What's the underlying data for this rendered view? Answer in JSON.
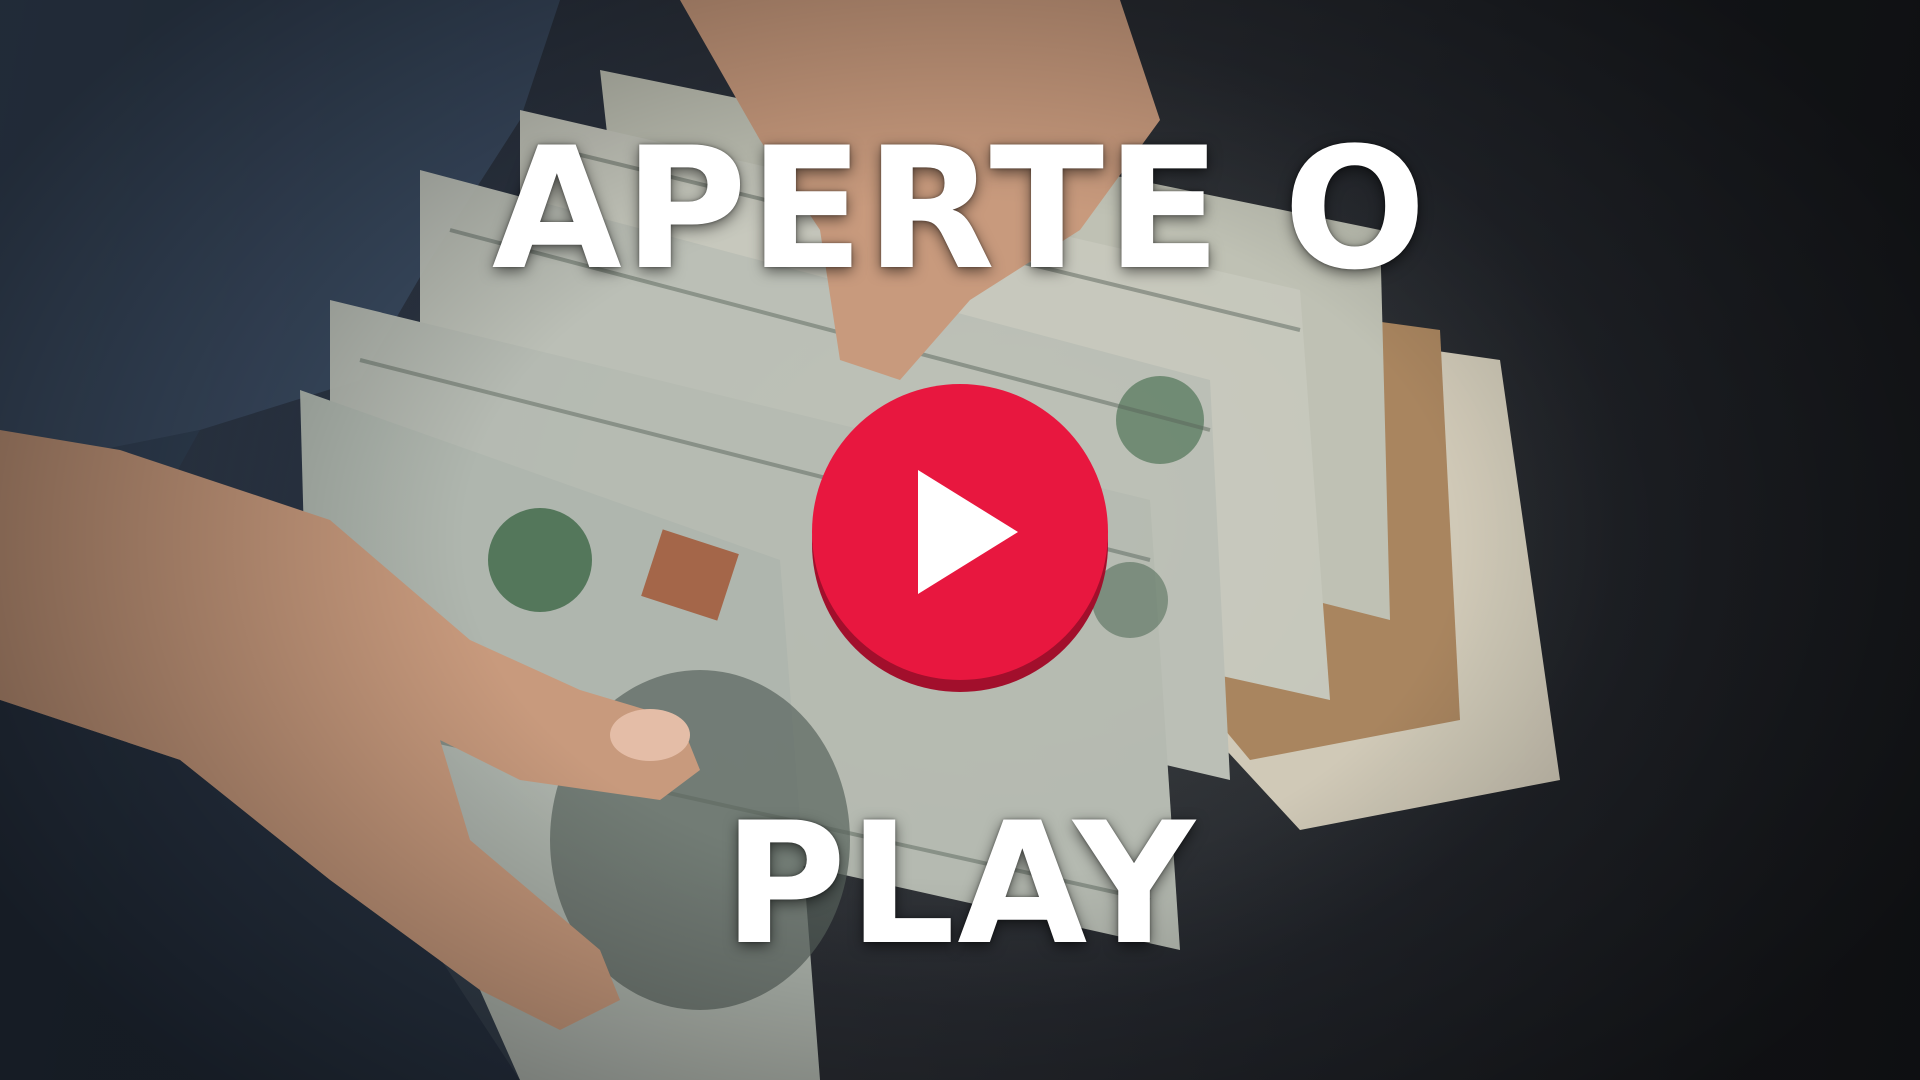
{
  "overlay": {
    "headline_top": "APERTE O",
    "headline_bottom": "PLAY"
  },
  "play_button": {
    "icon": "play-icon",
    "color": "#e8173f",
    "shadow_color": "#a20f2c",
    "glyph_color": "#ffffff"
  },
  "background": {
    "subject": "hands-holding-dollar-bills"
  }
}
